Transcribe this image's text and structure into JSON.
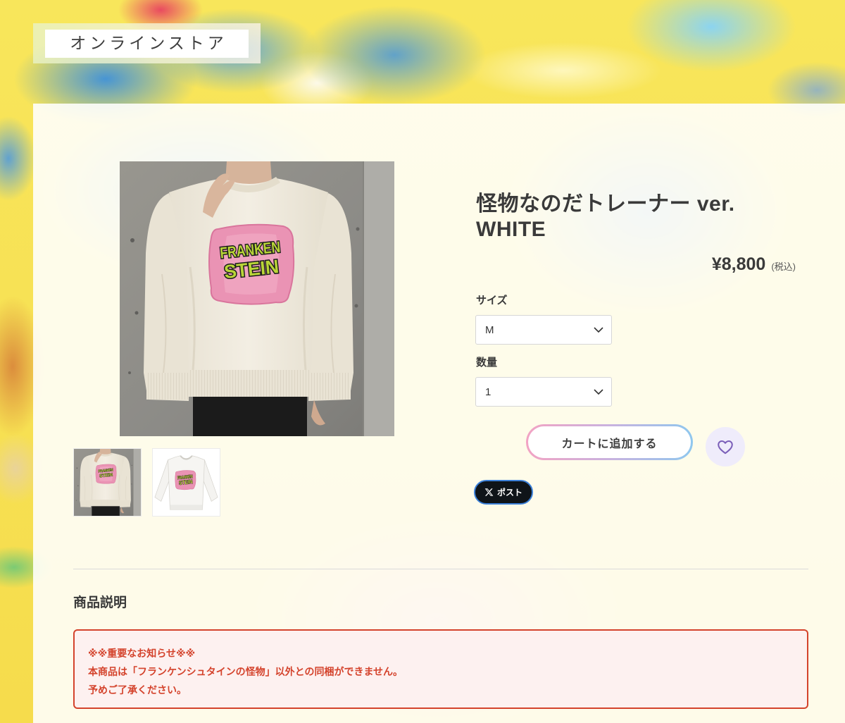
{
  "header": {
    "store_label": "オンラインストア"
  },
  "product": {
    "title": "怪物なのだトレーナー ver. WHITE",
    "price": "¥8,800",
    "tax_note": "(税込)",
    "shirt_graphic_text": [
      "FRANKEN",
      "STEIN"
    ]
  },
  "options": {
    "size_label": "サイズ",
    "size_value": "M",
    "quantity_label": "数量",
    "quantity_value": "1",
    "select_icon": "chevron-down-icon"
  },
  "actions": {
    "add_to_cart_label": "カートに追加する",
    "favorite_icon": "heart-icon",
    "share_icon": "x-logo-icon",
    "share_label": "ポスト"
  },
  "description": {
    "heading": "商品説明",
    "notice_lines": [
      "※※重要なお知らせ※※",
      "本商品は「フランケンシュタインの怪物」以外との同梱ができません。",
      "予めご了承ください。"
    ]
  },
  "colors": {
    "page_bg": "#f6e34f",
    "text_main": "#3a3a3a",
    "notice_red": "#d4432c",
    "notice_bg": "#fdf1f0",
    "cart_gradient_start": "#f2a3c3",
    "cart_gradient_end": "#8fc7ee",
    "favorite_bg": "#efecfb",
    "favorite_icon": "#7b5fb9",
    "share_bg": "#0f1419",
    "share_border": "#3a7fd8"
  }
}
